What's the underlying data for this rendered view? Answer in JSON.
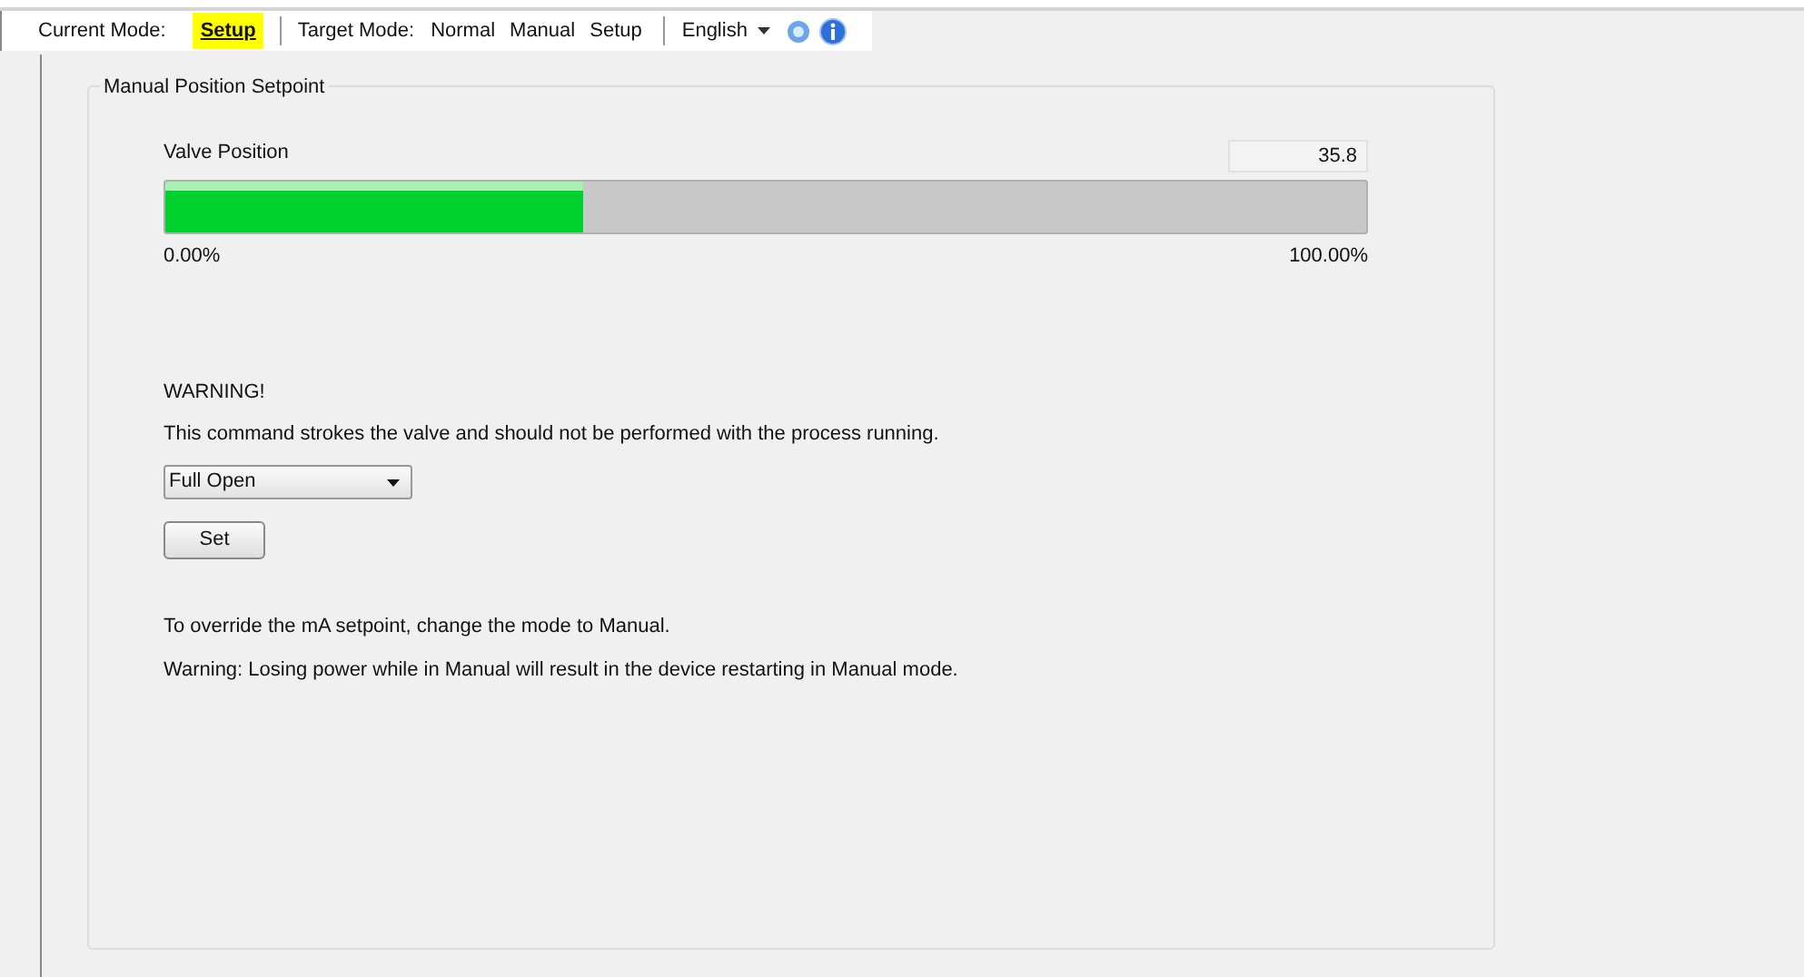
{
  "toolbar": {
    "current_mode_label": "Current Mode:",
    "current_mode": "Setup",
    "target_mode_label": "Target Mode:",
    "target_modes": [
      "Normal",
      "Manual",
      "Setup"
    ],
    "language": "English"
  },
  "panel": {
    "title": "Manual Position Setpoint",
    "valve_label": "Valve Position",
    "valve_value": "35.8",
    "valve": {
      "level": 0.348
    },
    "min_label": "0.00%",
    "max_label": "100.00%",
    "warning_title": "WARNING!",
    "warning_text": "This command strokes the valve and should not be performed with the process running.",
    "command": {
      "value": "Full Open"
    },
    "set_button": "Set",
    "notes": [
      "To override the mA setpoint, change the mode to Manual.",
      "Warning: Losing power while in Manual will result in the device restarting in Manual mode."
    ]
  }
}
